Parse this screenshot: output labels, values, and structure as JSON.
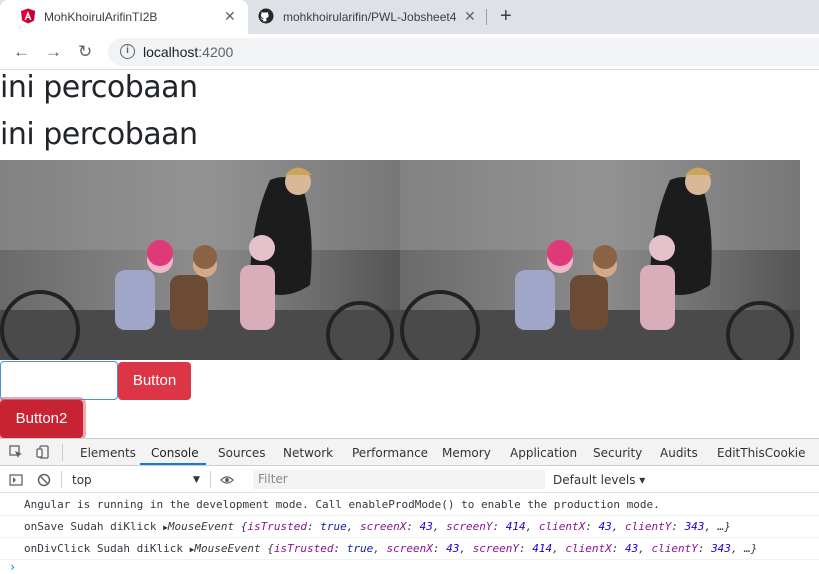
{
  "browser": {
    "tabs": [
      {
        "title": "MohKhoirulArifinTI2B",
        "active": true,
        "icon": "angular-icon"
      },
      {
        "title": "mohkhoirularifin/PWL-Jobsheet4",
        "active": false,
        "icon": "github-icon"
      }
    ],
    "close_glyph": "✕",
    "new_tab_glyph": "+",
    "back_glyph": "←",
    "forward_glyph": "→",
    "reload_glyph": "↻",
    "info_glyph": "i",
    "url_host": "localhost",
    "url_port": ":4200"
  },
  "page": {
    "headings": [
      "ini percobaan",
      "ini percobaan"
    ],
    "input_value": "",
    "button1_label": "Button",
    "button2_label": "Button2",
    "button_color": "#dc3545"
  },
  "devtools": {
    "tabs": [
      "Elements",
      "Console",
      "Sources",
      "Network",
      "Performance",
      "Memory",
      "Application",
      "Security",
      "Audits",
      "EditThisCookie"
    ],
    "selected_tab": "Console",
    "context": "top",
    "filter_placeholder": "Filter",
    "levels": "Default levels ▾",
    "logs": [
      {
        "text": "Angular is running in the development mode. Call enableProdMode() to enable the production mode."
      },
      {
        "prefix": "onSave Sudah diKlick ",
        "object": "MouseEvent"
      },
      {
        "prefix": "onDivClick Sudah diKlick ",
        "object": "MouseEvent"
      }
    ],
    "event": {
      "isTrusted": "true",
      "screenX": "43",
      "screenY": "414",
      "clientX": "43",
      "clientY": "343"
    },
    "prompt": "›"
  }
}
